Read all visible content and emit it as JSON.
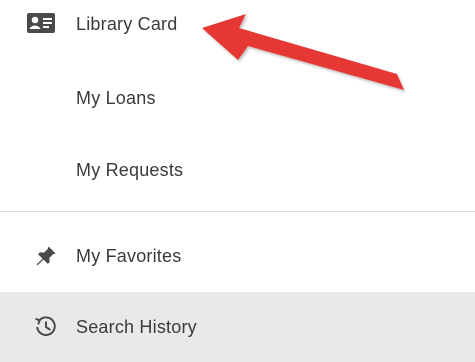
{
  "menu": {
    "items": [
      {
        "label": "Library Card",
        "icon": "id-card-icon"
      },
      {
        "label": "My Loans",
        "icon": ""
      },
      {
        "label": "My Requests",
        "icon": ""
      },
      {
        "label": "My Favorites",
        "icon": "pushpin-icon"
      },
      {
        "label": "Search History",
        "icon": "history-icon"
      }
    ],
    "selected": "Search History"
  },
  "annotation": {
    "type": "arrow",
    "color": "#e53935",
    "points_to": "Library Card"
  },
  "colors": {
    "text": "#3a3a3a",
    "divider": "#dcdcdc",
    "selected_background": "#e9e9e9",
    "arrow": "#e53935"
  }
}
